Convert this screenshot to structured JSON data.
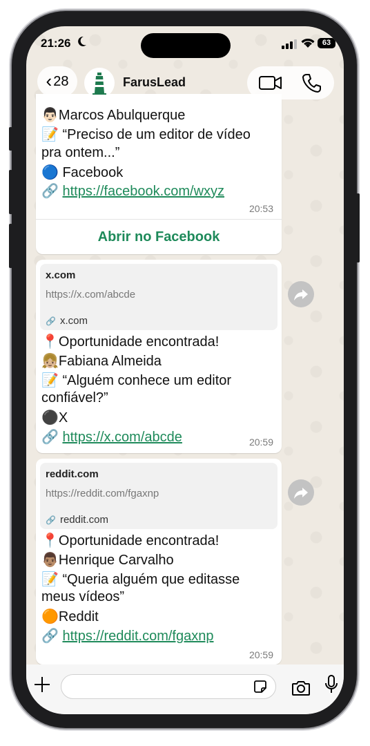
{
  "status_bar": {
    "time": "21:26",
    "battery": "63"
  },
  "header": {
    "back_count": "28",
    "contact_name": "FarusLead"
  },
  "messages": [
    {
      "lines": [
        {
          "emoji": "👨🏻",
          "text": "Marcos Abulquerque"
        },
        {
          "emoji": "📝",
          "text": " “Preciso de um editor de vídeo"
        },
        {
          "emoji": "",
          "text": "pra ontem...”"
        },
        {
          "emoji": "🔵",
          "text": " Facebook"
        }
      ],
      "link": "https://facebook.com/wxyz",
      "time": "20:53",
      "action_label": "Abrir no Facebook"
    },
    {
      "preview": {
        "title": "x.com",
        "url": "https://x.com/abcde",
        "domain": "x.com"
      },
      "lines": [
        {
          "emoji": "📍",
          "text": "Oportunidade encontrada!"
        },
        {
          "emoji": "👧🏼",
          "text": "Fabiana Almeida"
        },
        {
          "emoji": "📝",
          "text": " “Alguém conhece um editor"
        },
        {
          "emoji": "",
          "text": "confiável?”"
        },
        {
          "emoji": "⚫",
          "text": "X"
        }
      ],
      "link": "https://x.com/abcde",
      "time": "20:59"
    },
    {
      "preview": {
        "title": "reddit.com",
        "url": "https://reddit.com/fgaxnp",
        "domain": "reddit.com"
      },
      "lines": [
        {
          "emoji": "📍",
          "text": "Oportunidade encontrada!"
        },
        {
          "emoji": "👨🏽",
          "text": "Henrique Carvalho"
        },
        {
          "emoji": "📝",
          "text": " “Queria alguém que editasse"
        },
        {
          "emoji": "",
          "text": "meus vídeos”"
        },
        {
          "emoji": "🟠",
          "text": "Reddit"
        }
      ],
      "link": "https://reddit.com/fgaxnp",
      "time": "20:59"
    }
  ],
  "link_emoji": "🔗",
  "icons": {
    "back": "chevron-left-icon",
    "video": "video-call-icon",
    "phone": "phone-call-icon",
    "forward": "forward-icon",
    "plus": "plus-icon",
    "sticker": "sticker-icon",
    "camera": "camera-icon",
    "mic": "microphone-icon"
  },
  "colors": {
    "link": "#1e8a5a",
    "wallpaper": "#efeae2",
    "bubble": "#ffffff"
  }
}
